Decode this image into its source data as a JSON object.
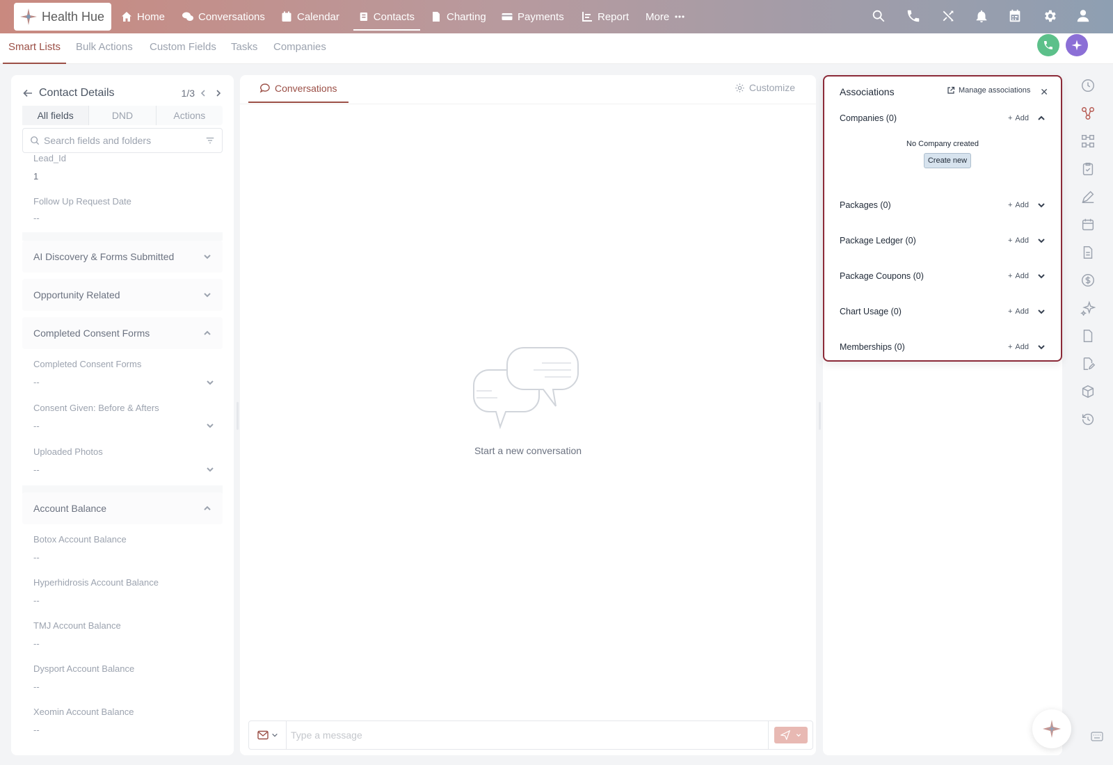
{
  "brand": {
    "name": "Health Hue"
  },
  "nav": {
    "items": [
      {
        "label": "Home",
        "icon": "home-icon"
      },
      {
        "label": "Conversations",
        "icon": "chat-icon"
      },
      {
        "label": "Calendar",
        "icon": "calendar-icon"
      },
      {
        "label": "Contacts",
        "icon": "contacts-icon"
      },
      {
        "label": "Charting",
        "icon": "document-icon"
      },
      {
        "label": "Payments",
        "icon": "card-icon"
      },
      {
        "label": "Report",
        "icon": "report-icon"
      },
      {
        "label": "More",
        "icon": "more-icon"
      }
    ],
    "active": "Contacts"
  },
  "subnav": {
    "tabs": [
      "Smart Lists",
      "Bulk Actions",
      "Custom Fields",
      "Tasks",
      "Companies"
    ],
    "active": "Smart Lists"
  },
  "contact_details": {
    "title": "Contact Details",
    "pager": "1/3",
    "tabs": [
      "All fields",
      "DND",
      "Actions"
    ],
    "search_placeholder": "Search fields and folders",
    "fields_top": [
      {
        "label": "Lead_Id",
        "value": "1"
      },
      {
        "label": "Follow Up Request Date",
        "value": "--"
      }
    ],
    "sections": {
      "ai_discovery": "AI Discovery & Forms Submitted",
      "opportunity": "Opportunity Related",
      "consent": "Completed Consent Forms",
      "account_balance": "Account Balance"
    },
    "consent_fields": [
      {
        "label": "Completed Consent Forms",
        "value": "--"
      },
      {
        "label": "Consent Given: Before & Afters",
        "value": "--"
      },
      {
        "label": "Uploaded Photos",
        "value": "--"
      }
    ],
    "balance_fields": [
      {
        "label": "Botox Account Balance",
        "value": "--"
      },
      {
        "label": "Hyperhidrosis Account Balance",
        "value": "--"
      },
      {
        "label": "TMJ Account Balance",
        "value": "--"
      },
      {
        "label": "Dysport Account Balance",
        "value": "--"
      },
      {
        "label": "Xeomin Account Balance",
        "value": "--"
      }
    ]
  },
  "conversations": {
    "tab": "Conversations",
    "customize": "Customize",
    "empty_text": "Start a new conversation",
    "composer_placeholder": "Type a message"
  },
  "associations": {
    "title": "Associations",
    "manage": "Manage associations",
    "add_label": "Add",
    "no_company": "No Company created",
    "create_new": "Create new",
    "rows": [
      {
        "label": "Companies (0)"
      },
      {
        "label": "Packages (0)"
      },
      {
        "label": "Package Ledger (0)"
      },
      {
        "label": "Package Coupons (0)"
      },
      {
        "label": "Chart Usage (0)"
      },
      {
        "label": "Memberships (0)"
      }
    ]
  },
  "colors": {
    "accent": "#9b4f46",
    "assoc_border": "#8b2a38",
    "phone_btn": "#5cc08a",
    "ai_btn": "#8b6fd6"
  }
}
